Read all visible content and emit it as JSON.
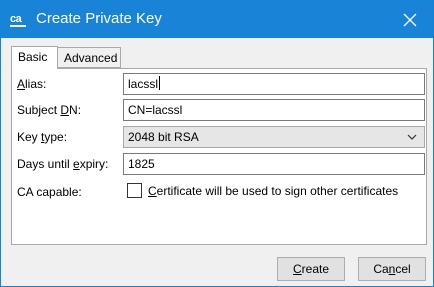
{
  "window": {
    "title": "Create Private Key",
    "app_icon_text": "ca"
  },
  "tabs": [
    {
      "label": "Basic",
      "active": true
    },
    {
      "label": "Advanced",
      "active": false
    }
  ],
  "form": {
    "alias": {
      "label_pre": "",
      "label_mn": "A",
      "label_post": "lias:",
      "value": "lacssl"
    },
    "subject_dn": {
      "label_pre": "Subject ",
      "label_mn": "D",
      "label_post": "N:",
      "value": "CN=lacssl"
    },
    "key_type": {
      "label_pre": "Key ",
      "label_mn": "t",
      "label_post": "ype:",
      "value": "2048 bit RSA"
    },
    "days_until_expiry": {
      "label_pre": "Days until ",
      "label_mn": "e",
      "label_post": "xpiry:",
      "value": "1825"
    },
    "ca_capable": {
      "label": "CA capable:",
      "checked": false,
      "checkbox_mn": "C",
      "checkbox_rest": "ertificate will be used to sign other certificates"
    }
  },
  "buttons": {
    "create": {
      "mn": "C",
      "rest": "reate"
    },
    "cancel": {
      "pre": "Ca",
      "mn": "n",
      "rest": "cel"
    }
  },
  "colors": {
    "titlebar": "#1883d7",
    "window_bg": "#f0f0f0"
  }
}
